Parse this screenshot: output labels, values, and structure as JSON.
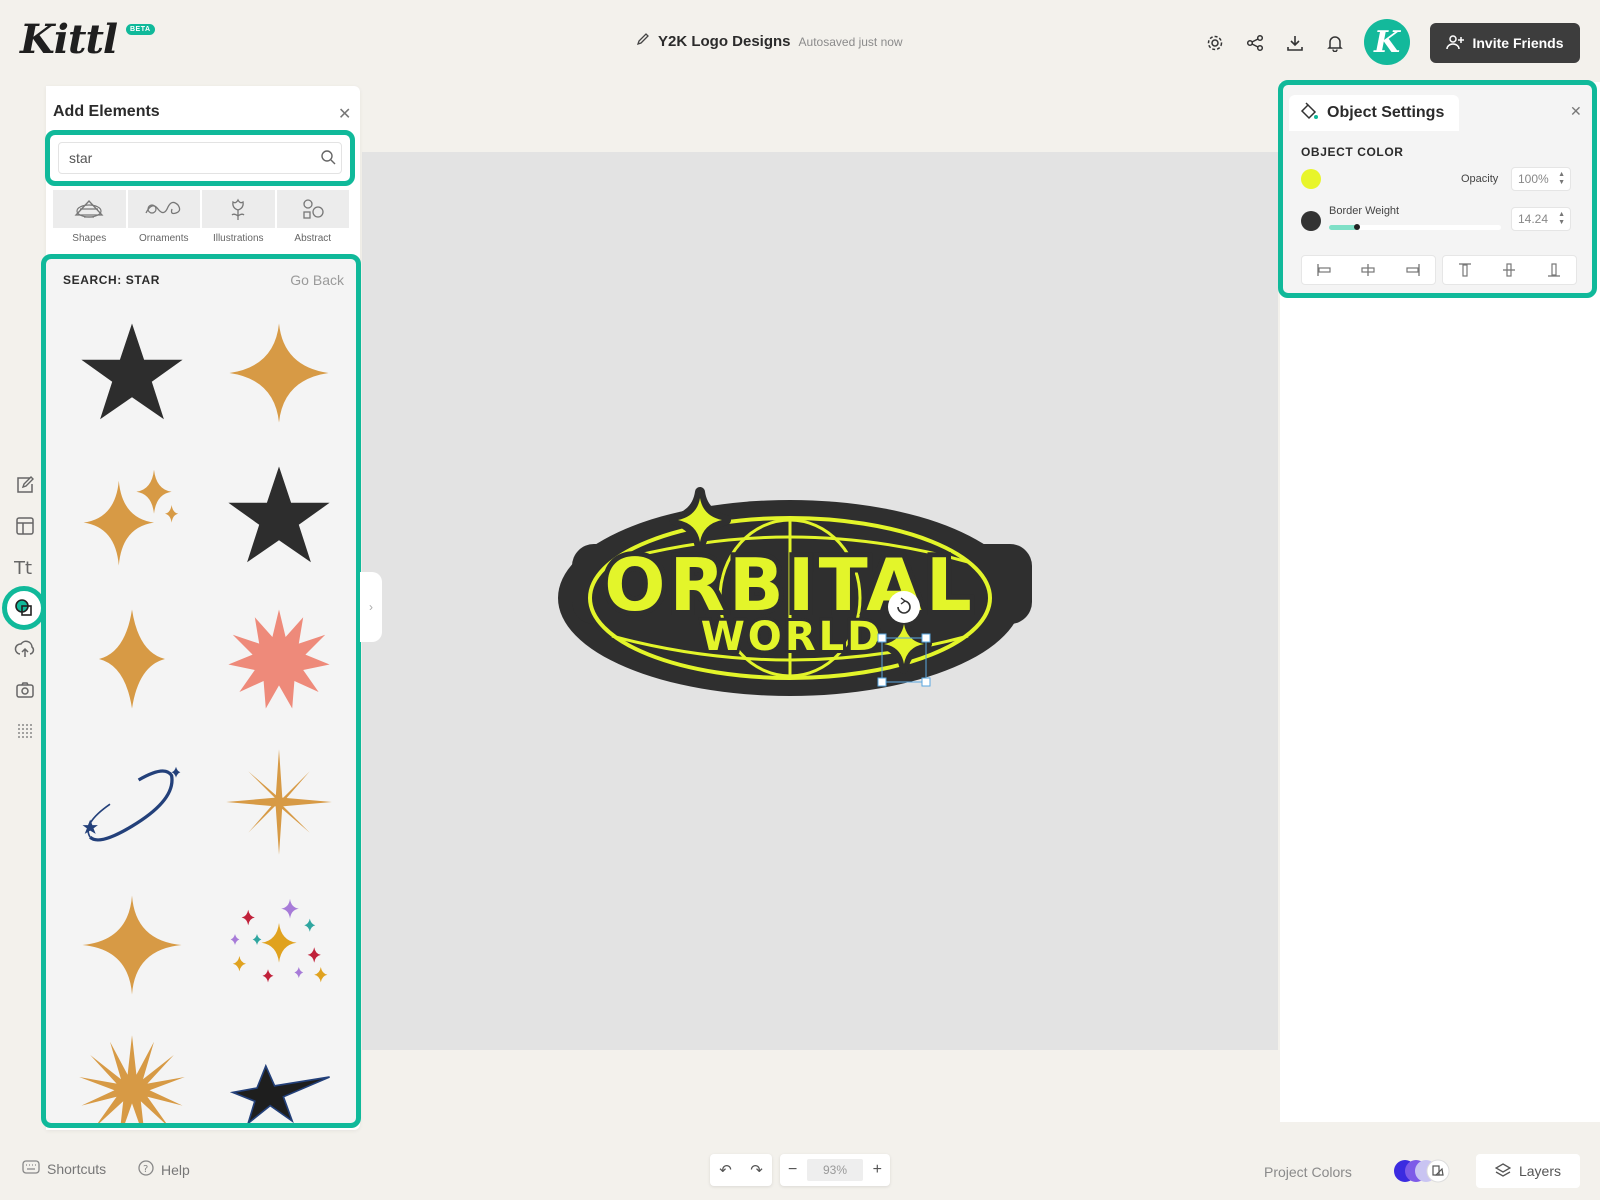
{
  "app": {
    "logo_text": "Kittl",
    "beta_badge": "BETA"
  },
  "header": {
    "doc_title": "Y2K Logo Designs",
    "autosave_status": "Autosaved just now",
    "avatar_letter": "K",
    "invite_label": "Invite Friends"
  },
  "add_elements": {
    "title": "Add Elements",
    "search_value": "star",
    "categories": [
      {
        "label": "Shapes"
      },
      {
        "label": "Ornaments"
      },
      {
        "label": "Illustrations"
      },
      {
        "label": "Abstract"
      }
    ],
    "results_header": "SEARCH: STAR",
    "go_back_label": "Go Back"
  },
  "canvas": {
    "logo_line1": "ORBITAL",
    "logo_line2": "WORLD",
    "accent_color": "#e3f52a",
    "badge_color": "#2f2f2f"
  },
  "object_settings": {
    "title": "Object Settings",
    "section_label": "OBJECT COLOR",
    "fill_color": "#e8f52a",
    "opacity_label": "Opacity",
    "opacity_value": "100%",
    "border_color": "#333333",
    "border_weight_label": "Border Weight",
    "border_weight_value": "14.24"
  },
  "bottom": {
    "shortcuts_label": "Shortcuts",
    "help_label": "Help",
    "zoom_value": "93%",
    "project_colors_label": "Project Colors",
    "layers_label": "Layers"
  },
  "theme": {
    "accent": "#10b99a",
    "star_gold": "#d79a45",
    "star_dark": "#2d2d2d",
    "burst_pink": "#ee8a7a"
  }
}
